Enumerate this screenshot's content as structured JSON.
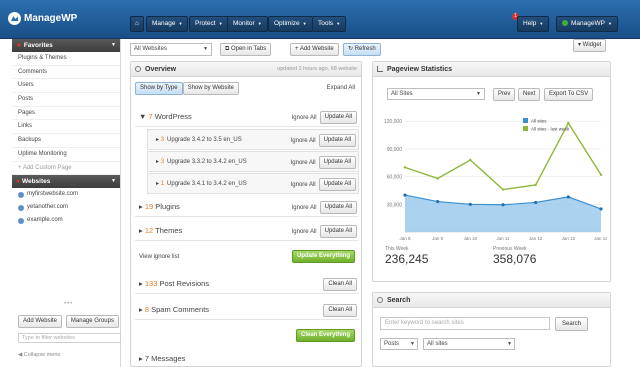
{
  "brand": {
    "name": "ManageWP"
  },
  "topnav": {
    "manage": "Manage",
    "protect": "Protect",
    "monitor": "Monitor",
    "optimize": "Optimize",
    "tools": "Tools",
    "help": "Help",
    "account": "ManageWP",
    "notification_count": "1"
  },
  "sidebar": {
    "favorites_title": "Favorites",
    "favorites": [
      "Plugins & Themes",
      "Comments",
      "Users",
      "Posts",
      "Pages",
      "Links",
      "Backups",
      "Uptime Monitoring"
    ],
    "add_custom_page": "+ Add Custom Page",
    "websites_title": "Websites",
    "websites": [
      "myfirstwebsite.com",
      "yetanother.com",
      "example.com"
    ],
    "add_website": "Add Website",
    "manage_groups": "Manage Groups",
    "filter_placeholder": "Type to filter websites",
    "collapse": "◀ Collapse menu"
  },
  "toolbar": {
    "site_select": "All Websites",
    "open_in_tabs": "Open in Tabs",
    "add_website": "+ Add Website",
    "refresh": "Refresh",
    "widget": "▾ Widget"
  },
  "overview": {
    "title": "Overview",
    "updated": "updated 2 hours ago, 68 website",
    "show_by_type": "Show by Type",
    "show_by_website": "Show by Website",
    "expand_all": "Expand All",
    "ignore_all": "Ignore All",
    "update_all": "Update All",
    "clean_all": "Clean All",
    "wordpress": {
      "count": "7",
      "label": "WordPress"
    },
    "upgrades": [
      {
        "count": "3",
        "label": "Upgrade 3.4.2 to 3.5 en_US"
      },
      {
        "count": "3",
        "label": "Upgrade 3.3.2 to 3.4.2 en_US"
      },
      {
        "count": "1",
        "label": "Upgrade 3.4.1 to 3.4.2 en_US"
      }
    ],
    "plugins": {
      "count": "19",
      "label": "Plugins"
    },
    "themes": {
      "count": "12",
      "label": "Themes"
    },
    "view_ignore_list": "View ignore list",
    "update_everything": "Update Everything",
    "revisions": {
      "count": "133",
      "label": "Post Revisions"
    },
    "spam": {
      "count": "8",
      "label": "Spam Comments"
    },
    "clean_everything": "Clean Everything",
    "messages": {
      "count": "7",
      "label": "Messages"
    }
  },
  "stats": {
    "title": "Pageview Statistics",
    "site_select": "All Sites",
    "prev": "Prev",
    "next": "Next",
    "export": "Export To CSV",
    "this_week_label": "This Week",
    "this_week_value": "236,245",
    "previous_week_label": "Previous Week",
    "previous_week_value": "358,076"
  },
  "chart_data": {
    "type": "line",
    "x": [
      "Jan 8",
      "Jan 9",
      "Jan 10",
      "Jan 11",
      "Jan 12",
      "Jan 13",
      "Jan 14"
    ],
    "series": [
      {
        "name": "All sites",
        "type": "area",
        "color": "#3b8fd1",
        "values": [
          40000,
          33000,
          30000,
          29500,
          32000,
          38000,
          25000
        ]
      },
      {
        "name": "All sites - last week",
        "type": "line",
        "color": "#8fb83a",
        "values": [
          70000,
          58000,
          78000,
          46000,
          51000,
          118000,
          62000
        ]
      }
    ],
    "y_ticks": [
      30000,
      60000,
      90000,
      120000
    ],
    "y_tick_labels": [
      "30,000",
      "60,000",
      "90,000",
      "120,000"
    ],
    "ylim": [
      0,
      130000
    ],
    "legend": "top-right"
  },
  "search": {
    "title": "Search",
    "placeholder": "Enter keyword to search sites",
    "button": "Search",
    "type_select": "Posts",
    "site_select": "All sites"
  }
}
